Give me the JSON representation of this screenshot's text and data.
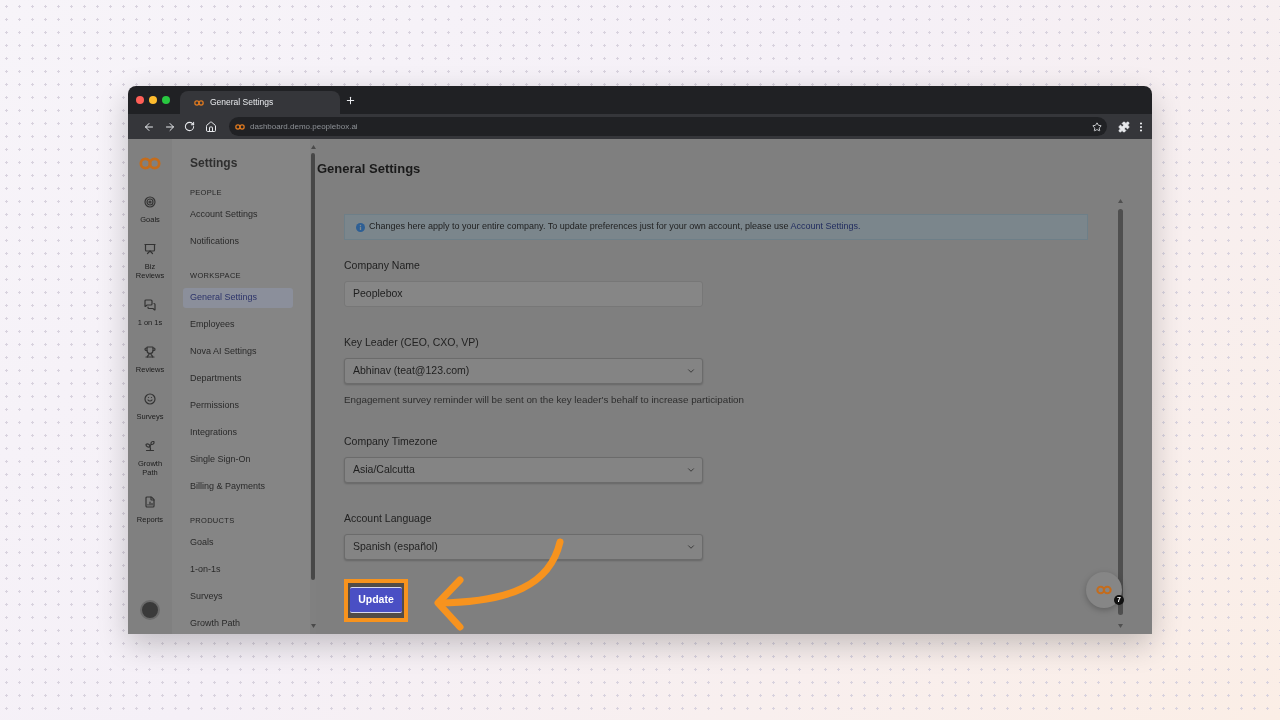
{
  "browser": {
    "tab_title": "General Settings",
    "url": "dashboard.demo.peoplebox.ai"
  },
  "nav_rail": {
    "items": [
      {
        "kind": "goals",
        "label": "Goals"
      },
      {
        "kind": "biz_reviews",
        "label": "Biz Reviews"
      },
      {
        "kind": "one_on_ones",
        "label": "1 on 1s"
      },
      {
        "kind": "reviews",
        "label": "Reviews"
      },
      {
        "kind": "surveys",
        "label": "Surveys"
      },
      {
        "kind": "growth_path",
        "label": "Growth Path"
      },
      {
        "kind": "reports",
        "label": "Reports"
      }
    ]
  },
  "sidebar": {
    "title": "Settings",
    "sections": [
      {
        "heading": "PEOPLE",
        "items": [
          {
            "label": "Account Settings",
            "selected": false
          },
          {
            "label": "Notifications",
            "selected": false
          }
        ]
      },
      {
        "heading": "WORKSPACE",
        "items": [
          {
            "label": "General Settings",
            "selected": true
          },
          {
            "label": "Employees",
            "selected": false
          },
          {
            "label": "Nova AI Settings",
            "selected": false
          },
          {
            "label": "Departments",
            "selected": false
          },
          {
            "label": "Permissions",
            "selected": false
          },
          {
            "label": "Integrations",
            "selected": false
          },
          {
            "label": "Single Sign-On",
            "selected": false
          },
          {
            "label": "Billing & Payments",
            "selected": false
          }
        ]
      },
      {
        "heading": "PRODUCTS",
        "items": [
          {
            "label": "Goals",
            "selected": false
          },
          {
            "label": "1-on-1s",
            "selected": false
          },
          {
            "label": "Surveys",
            "selected": false
          },
          {
            "label": "Growth Path",
            "selected": false
          }
        ]
      }
    ]
  },
  "main": {
    "title": "General Settings",
    "notice": {
      "text": "Changes here apply to your entire company. To update preferences just for your own account, please use",
      "link": "Account Settings."
    },
    "fields": [
      {
        "kind": "text",
        "label": "Company Name",
        "value": "Peoplebox"
      },
      {
        "kind": "select",
        "label": "Key Leader (CEO, CXO, VP)",
        "value": "Abhinav (teat@123.com)",
        "help": "Engagement survey reminder will be sent on the key leader's behalf to increase participation"
      },
      {
        "kind": "select",
        "label": "Company Timezone",
        "value": "Asia/Calcutta"
      },
      {
        "kind": "select",
        "label": "Account Language",
        "value": "Spanish (español)"
      }
    ],
    "update_button": {
      "label": "Update",
      "highlighted": true
    }
  },
  "chat_widget": {
    "badge": "7"
  }
}
